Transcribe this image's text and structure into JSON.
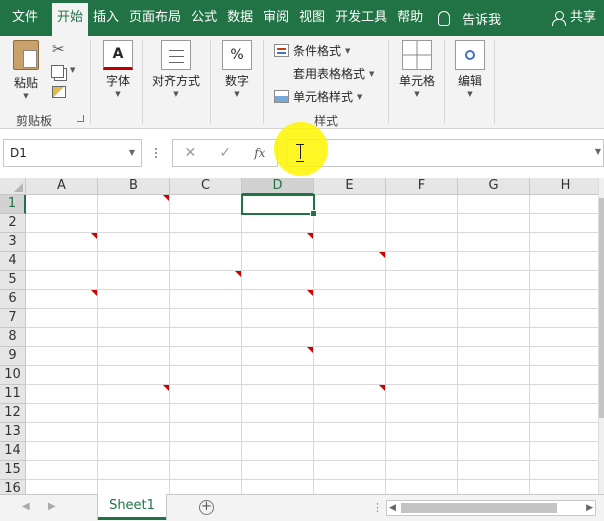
{
  "ribbon": {
    "tabs": [
      "文件",
      "开始",
      "插入",
      "页面布局",
      "公式",
      "数据",
      "审阅",
      "视图",
      "开发工具",
      "帮助"
    ],
    "active_tab": 1,
    "tell_me": "告诉我",
    "share": "共享",
    "paste": "粘贴",
    "clipboard_group": "剪贴板",
    "font_button": "字体",
    "font_icon": "A",
    "align_button": "对齐方式",
    "number_button": "数字",
    "number_icon": "%",
    "conditional_format": "条件格式",
    "table_format": "套用表格格式",
    "cell_style": "单元格样式",
    "styles_group": "样式",
    "cells_button": "单元格",
    "edit_button": "编辑"
  },
  "formula_bar": {
    "name_box": "D1",
    "fx": "fx",
    "cancel": "✕",
    "enter": "✓"
  },
  "grid": {
    "columns": [
      "A",
      "B",
      "C",
      "D",
      "E",
      "F",
      "G",
      "H"
    ],
    "rows": [
      "1",
      "2",
      "3",
      "4",
      "5",
      "6",
      "7",
      "8",
      "9",
      "10",
      "11",
      "12",
      "13",
      "14",
      "15",
      "16"
    ],
    "selected_column": "D",
    "selected_row": "1",
    "active_cell": "D1",
    "comment_cells": [
      "B1",
      "A3",
      "D3",
      "E4",
      "C5",
      "A6",
      "D6",
      "D9",
      "B11",
      "E11"
    ]
  },
  "sheets": {
    "tabs": [
      "Sheet1"
    ],
    "add_icon": "+"
  },
  "colors": {
    "accent": "#217346",
    "comment_marker": "#cc0000",
    "highlight": "#fff500"
  }
}
